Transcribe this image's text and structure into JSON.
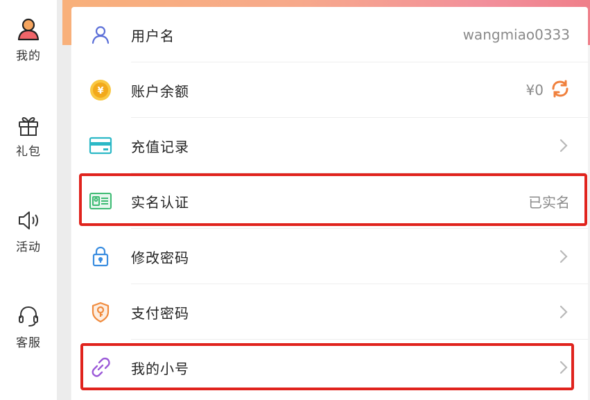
{
  "sidebar": {
    "items": [
      {
        "label": "我的",
        "icon": "user-avatar-icon"
      },
      {
        "label": "礼包",
        "icon": "gift-icon"
      },
      {
        "label": "活动",
        "icon": "speaker-icon"
      },
      {
        "label": "客服",
        "icon": "headset-icon"
      }
    ]
  },
  "account": {
    "rows": [
      {
        "label": "用户名",
        "value": "wangmiao0333",
        "icon": "user-outline-icon"
      },
      {
        "label": "账户余额",
        "value": "¥0",
        "icon": "yen-coin-icon",
        "action_icon": "refresh-icon"
      },
      {
        "label": "充值记录",
        "icon": "card-icon"
      },
      {
        "label": "实名认证",
        "value": "已实名",
        "icon": "id-card-icon"
      },
      {
        "label": "修改密码",
        "icon": "lock-icon"
      },
      {
        "label": "支付密码",
        "icon": "key-shield-icon"
      },
      {
        "label": "我的小号",
        "icon": "link-icon"
      }
    ]
  },
  "colors": {
    "highlight": "#e0231d",
    "banner_start": "#f8b07a",
    "banner_end": "#ef7f8a",
    "refresh_icon": "#f0803c"
  }
}
